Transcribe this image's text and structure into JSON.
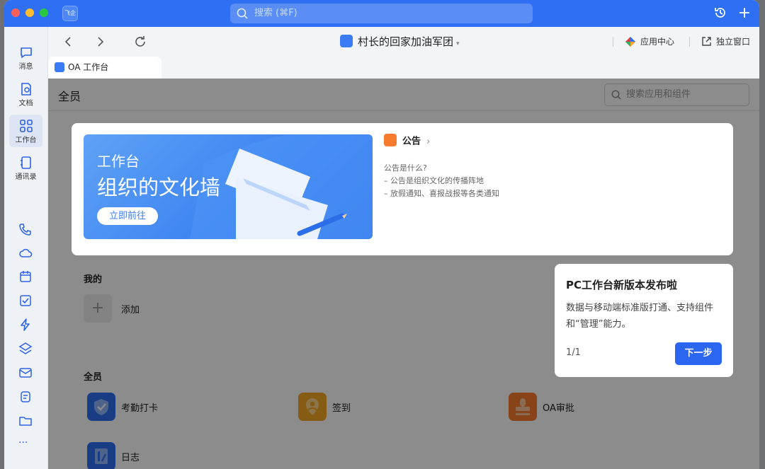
{
  "titlebar": {
    "app_logo_text": "飞企",
    "search_placeholder": "搜索 (⌘F)"
  },
  "sidebar": {
    "items": [
      {
        "label": "消息",
        "icon": "chat-bubble-icon"
      },
      {
        "label": "文档",
        "icon": "document-icon"
      },
      {
        "label": "工作台",
        "icon": "grid-icon"
      },
      {
        "label": "通讯录",
        "icon": "contacts-icon"
      }
    ],
    "more": "···"
  },
  "topbar": {
    "title": "村长的回家加油军团",
    "app_center": "应用中心",
    "standalone": "独立窗口"
  },
  "tab": {
    "label": "OA 工作台"
  },
  "content": {
    "title": "全员",
    "search_placeholder": "搜索应用和组件",
    "banner": {
      "small": "工作台",
      "big": "组织的文化墙",
      "button": "立即前往"
    },
    "notice": {
      "title": "公告",
      "lines": [
        "公告是什么?",
        "– 公告是组织文化的传播阵地",
        "– 放假通知、喜报战报等各类通知"
      ]
    },
    "mine_title": "我的",
    "add_label": "添加",
    "all_title": "全员",
    "apps": [
      {
        "label": "考勤打卡",
        "color": "#2f6ff3"
      },
      {
        "label": "签到",
        "color": "#f5a623"
      },
      {
        "label": "OA审批",
        "color": "#f77b2c"
      },
      {
        "label": "日志",
        "color": "#2f6ff3"
      }
    ]
  },
  "popup": {
    "title": "PC工作台新版本发布啦",
    "desc": "数据与移动端标准版打通、支持组件和“管理”能力。",
    "page": "1/1",
    "next": "下一步"
  }
}
